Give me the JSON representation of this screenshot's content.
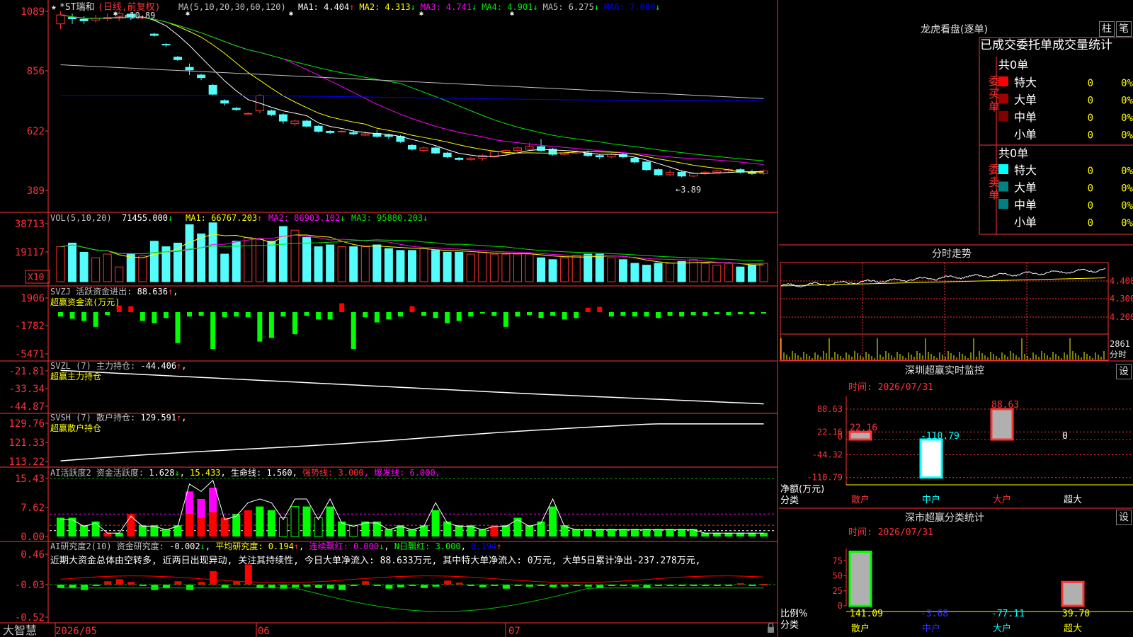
{
  "stock": {
    "name": "*ST瑞和",
    "period": "日线,前复权"
  },
  "colors": {
    "up": "#ff3232",
    "down": "#54fcfc",
    "grid": "#b00000",
    "axis": "#ff3232",
    "ma1": "#ffffff",
    "ma2": "#ffff00",
    "ma3": "#ff00ff",
    "ma4": "#00e600",
    "ma5": "#c0c0c0",
    "ma6": "#0000ff"
  },
  "price": {
    "axis": [
      "1089",
      "856",
      "622",
      "389"
    ],
    "ma_label": "MA(5,10,20,30,60,120)",
    "ma": [
      {
        "label": "MA1: 4.404",
        "arrow": "↑",
        "color": "#ffffff"
      },
      {
        "label": "MA2: 4.313",
        "arrow": "↓",
        "color": "#ffff00"
      },
      {
        "label": "MA3: 4.741",
        "arrow": "↓",
        "color": "#ff00ff"
      },
      {
        "label": "MA4: 4.901",
        "arrow": "↓",
        "color": "#00e600"
      },
      {
        "label": "MA5: 6.275",
        "arrow": "↓",
        "color": "#c0c0c0"
      },
      {
        "label": "MA6: 7.080",
        "arrow": "↓",
        "color": "#0000ff"
      }
    ],
    "high_label": "10.89",
    "low_label": "3.89",
    "candles": [
      [
        1040,
        1075,
        1020,
        1090
      ],
      [
        1065,
        1060,
        1040,
        1080
      ],
      [
        1058,
        1052,
        1040,
        1070
      ],
      [
        1055,
        1062,
        1045,
        1075
      ],
      [
        1060,
        1065,
        1050,
        1080
      ],
      [
        1070,
        1080,
        1050,
        1090
      ],
      [
        1078,
        1065,
        1055,
        1085
      ],
      [
        1065,
        1065,
        1060,
        1075
      ],
      [
        1000,
        995,
        990,
        1005
      ],
      [
        960,
        958,
        950,
        965
      ],
      [
        910,
        900,
        895,
        915
      ],
      [
        870,
        860,
        840,
        885
      ],
      [
        840,
        830,
        820,
        845
      ],
      [
        800,
        765,
        760,
        805
      ],
      [
        740,
        730,
        720,
        745
      ],
      [
        710,
        705,
        700,
        715
      ],
      [
        690,
        690,
        685,
        695
      ],
      [
        700,
        760,
        690,
        765
      ],
      [
        700,
        685,
        680,
        705
      ],
      [
        685,
        660,
        650,
        690
      ],
      [
        650,
        660,
        640,
        665
      ],
      [
        660,
        640,
        635,
        665
      ],
      [
        640,
        620,
        615,
        645
      ],
      [
        620,
        615,
        610,
        625
      ],
      [
        620,
        620,
        615,
        625
      ],
      [
        615,
        610,
        605,
        625
      ],
      [
        605,
        610,
        600,
        620
      ],
      [
        612,
        600,
        595,
        625
      ],
      [
        605,
        600,
        590,
        610
      ],
      [
        600,
        580,
        575,
        605
      ],
      [
        565,
        550,
        545,
        570
      ],
      [
        545,
        555,
        540,
        560
      ],
      [
        555,
        535,
        530,
        560
      ],
      [
        535,
        520,
        515,
        540
      ],
      [
        515,
        510,
        505,
        520
      ],
      [
        510,
        515,
        505,
        520
      ],
      [
        515,
        525,
        505,
        530
      ],
      [
        520,
        540,
        515,
        545
      ],
      [
        535,
        545,
        525,
        550
      ],
      [
        545,
        555,
        540,
        560
      ],
      [
        550,
        560,
        545,
        575
      ],
      [
        560,
        545,
        540,
        590
      ],
      [
        550,
        530,
        525,
        555
      ],
      [
        530,
        535,
        525,
        540
      ],
      [
        535,
        540,
        530,
        545
      ],
      [
        535,
        525,
        520,
        545
      ],
      [
        525,
        520,
        510,
        530
      ],
      [
        520,
        530,
        515,
        535
      ],
      [
        530,
        520,
        515,
        535
      ],
      [
        515,
        500,
        495,
        520
      ],
      [
        500,
        470,
        465,
        505
      ],
      [
        470,
        450,
        445,
        475
      ],
      [
        450,
        460,
        445,
        470
      ],
      [
        460,
        445,
        440,
        465
      ],
      [
        445,
        455,
        440,
        460
      ],
      [
        455,
        460,
        450,
        465
      ],
      [
        460,
        465,
        455,
        470
      ],
      [
        465,
        470,
        460,
        475
      ],
      [
        470,
        460,
        455,
        475
      ],
      [
        460,
        455,
        450,
        470
      ],
      [
        455,
        465,
        450,
        470
      ]
    ]
  },
  "vol": {
    "title": "VOL(5,10,20)",
    "value": "71455.000",
    "value_arrow": "↓",
    "ma": [
      {
        "label": "MA1: 66767.203",
        "arrow": "↑",
        "color": "#ffff00"
      },
      {
        "label": "MA2: 86903.102",
        "arrow": "↓",
        "color": "#ff00ff"
      },
      {
        "label": "MA3: 95880.203",
        "arrow": "↓",
        "color": "#00e600"
      }
    ],
    "axis": [
      "38713",
      "19117"
    ],
    "unit": "X10",
    "bars": [
      38,
      42,
      32,
      26,
      30,
      16,
      30,
      28,
      44,
      38,
      42,
      62,
      52,
      64,
      30,
      44,
      48,
      46,
      44,
      60,
      56,
      48,
      38,
      40,
      38,
      38,
      38,
      40,
      36,
      34,
      34,
      36,
      34,
      32,
      32,
      30,
      32,
      30,
      30,
      30,
      30,
      26,
      24,
      26,
      28,
      30,
      30,
      26,
      24,
      20,
      18,
      20,
      20,
      22,
      24,
      20,
      18,
      20,
      16,
      18,
      20
    ]
  },
  "svzj": {
    "title": "SVZJ  活跃资金进出:",
    "value": "88.636",
    "arrow": "↑",
    "sub": "超赢资金流(万元)",
    "axis": [
      "1906",
      "-1782",
      "-5471"
    ],
    "bars": [
      -600,
      -900,
      -1200,
      -2000,
      -400,
      900,
      800,
      -1200,
      -1500,
      -800,
      -4200,
      -600,
      -500,
      -5000,
      -700,
      -600,
      -700,
      -4000,
      -3500,
      -600,
      -3000,
      -500,
      -1000,
      -1000,
      1200,
      -5000,
      -700,
      -1400,
      -1000,
      -600,
      800,
      -500,
      -800,
      -1500,
      -1200,
      -600,
      -200,
      -500,
      -2000,
      -600,
      -400,
      -800,
      -500,
      -1000,
      -800,
      600,
      700,
      -600,
      -500,
      -600,
      -600,
      -800,
      -500,
      -600,
      -400,
      -500,
      -300,
      -400,
      -300,
      -300,
      -200
    ]
  },
  "svzl": {
    "title": "SVZL (7) 主力持仓:",
    "value": "-44.406",
    "arrow": "↑",
    "sub": "超赢主力持仓",
    "axis": [
      "-21.81",
      "-33.34",
      "-44.87"
    ]
  },
  "svsh": {
    "title": "SVSH (7) 散户持仓:",
    "value": "129.591",
    "arrow": "↑",
    "sub": "超赢散户持仓",
    "axis": [
      "129.76",
      "121.33",
      "113.22"
    ]
  },
  "ai1": {
    "title": "AI活跃度2 资金活跃度:",
    "v1": "1.628",
    "v1_arrow": "↓",
    "v2": "15.433",
    "l3": "生命线:",
    "v3": "1.560",
    "l4": "强势线:",
    "v4": "3.000",
    "l5": "爆发线:",
    "v5": "6.000",
    "axis": [
      "15.43",
      "7.62",
      "0.00"
    ]
  },
  "ai2": {
    "title": "AI研究度2(10) 资金研究度:",
    "v1": "-0.002",
    "v1_arrow": "↓",
    "l2": "平均研究度:",
    "v2": "0.194",
    "v2_arrow": "↑",
    "l3": "连续飘红:",
    "v3": "0.000",
    "v3_arrow": "↓",
    "l4": "N日飘红:",
    "v4": "3.000",
    "v5": "0.194",
    "v5_arrow": "↑",
    "note": "近期大资金总体由空转多, 近两日出现异动, 关注其持续性, 今日大单净流入: 88.633万元, 其中特大单净流入: 0万元, 大单5日累计净出-237.278万元,",
    "axis": [
      "0.46",
      "-0.03",
      "-0.52"
    ]
  },
  "dates": [
    "2026/05",
    "06",
    "07"
  ],
  "footer": {
    "brand": "大智慧"
  },
  "lhb": {
    "title": "龙虎看盘(逐单)",
    "btn1": "柱",
    "btn2": "笔",
    "header": "已成交委托单成交量统计",
    "buy_total": "共0单",
    "buy_label": "委买单",
    "sell_total": "共0单",
    "sell_label": "委卖单",
    "buy_rows": [
      {
        "label": "特大",
        "count": "0",
        "pct": "0%",
        "color": "#ff0000"
      },
      {
        "label": "大单",
        "count": "0",
        "pct": "0%",
        "color": "#a00000"
      },
      {
        "label": "中单",
        "count": "0",
        "pct": "0%",
        "color": "#800000"
      },
      {
        "label": "小单",
        "count": "0",
        "pct": "0%",
        "color": "#000000"
      }
    ],
    "sell_rows": [
      {
        "label": "特大",
        "count": "0",
        "pct": "0%",
        "color": "#00ffff"
      },
      {
        "label": "大单",
        "count": "0",
        "pct": "0%",
        "color": "#008080"
      },
      {
        "label": "中单",
        "count": "0",
        "pct": "0%",
        "color": "#008080"
      },
      {
        "label": "小单",
        "count": "0",
        "pct": "0%",
        "color": "#000000"
      }
    ]
  },
  "fenshi": {
    "title": "分时走势",
    "axis": [
      "4.400",
      "4.300",
      "4.200"
    ],
    "vol_label": "2861",
    "vol_unit": "分时"
  },
  "monitor": {
    "title": "深圳超赢实时监控",
    "btn": "设",
    "time": "时间: 2026/07/31",
    "axis": [
      "88.63",
      "22.16",
      "0",
      "-44.32",
      "-110.79"
    ],
    "ylabel1": "净额(万元)",
    "ylabel2": "分类",
    "bars": [
      {
        "cat": "散户",
        "value": 22.16,
        "label": "22.16"
      },
      {
        "cat": "中户",
        "value": -110.79,
        "label": "-110.79"
      },
      {
        "cat": "大户",
        "value": 88.63,
        "label": "88.63"
      },
      {
        "cat": "超大",
        "value": 0,
        "label": "0"
      }
    ]
  },
  "classify": {
    "title": "深市超赢分类统计",
    "btn": "设",
    "time": "时间: 2026/07/31",
    "axis": [
      "75",
      "50",
      "25",
      "0"
    ],
    "ylabel1": "比例%",
    "ylabel2": "分类",
    "bars": [
      {
        "cat": "散户",
        "value": 141.09,
        "label": "141.09",
        "color": "#ffff00"
      },
      {
        "cat": "中户",
        "value": -3.68,
        "label": "-3.68",
        "color": "#3030ff"
      },
      {
        "cat": "大户",
        "value": -77.11,
        "label": "-77.11",
        "color": "#00ffff"
      },
      {
        "cat": "超大",
        "value": 39.7,
        "label": "39.70",
        "color": "#ffff00"
      }
    ]
  }
}
